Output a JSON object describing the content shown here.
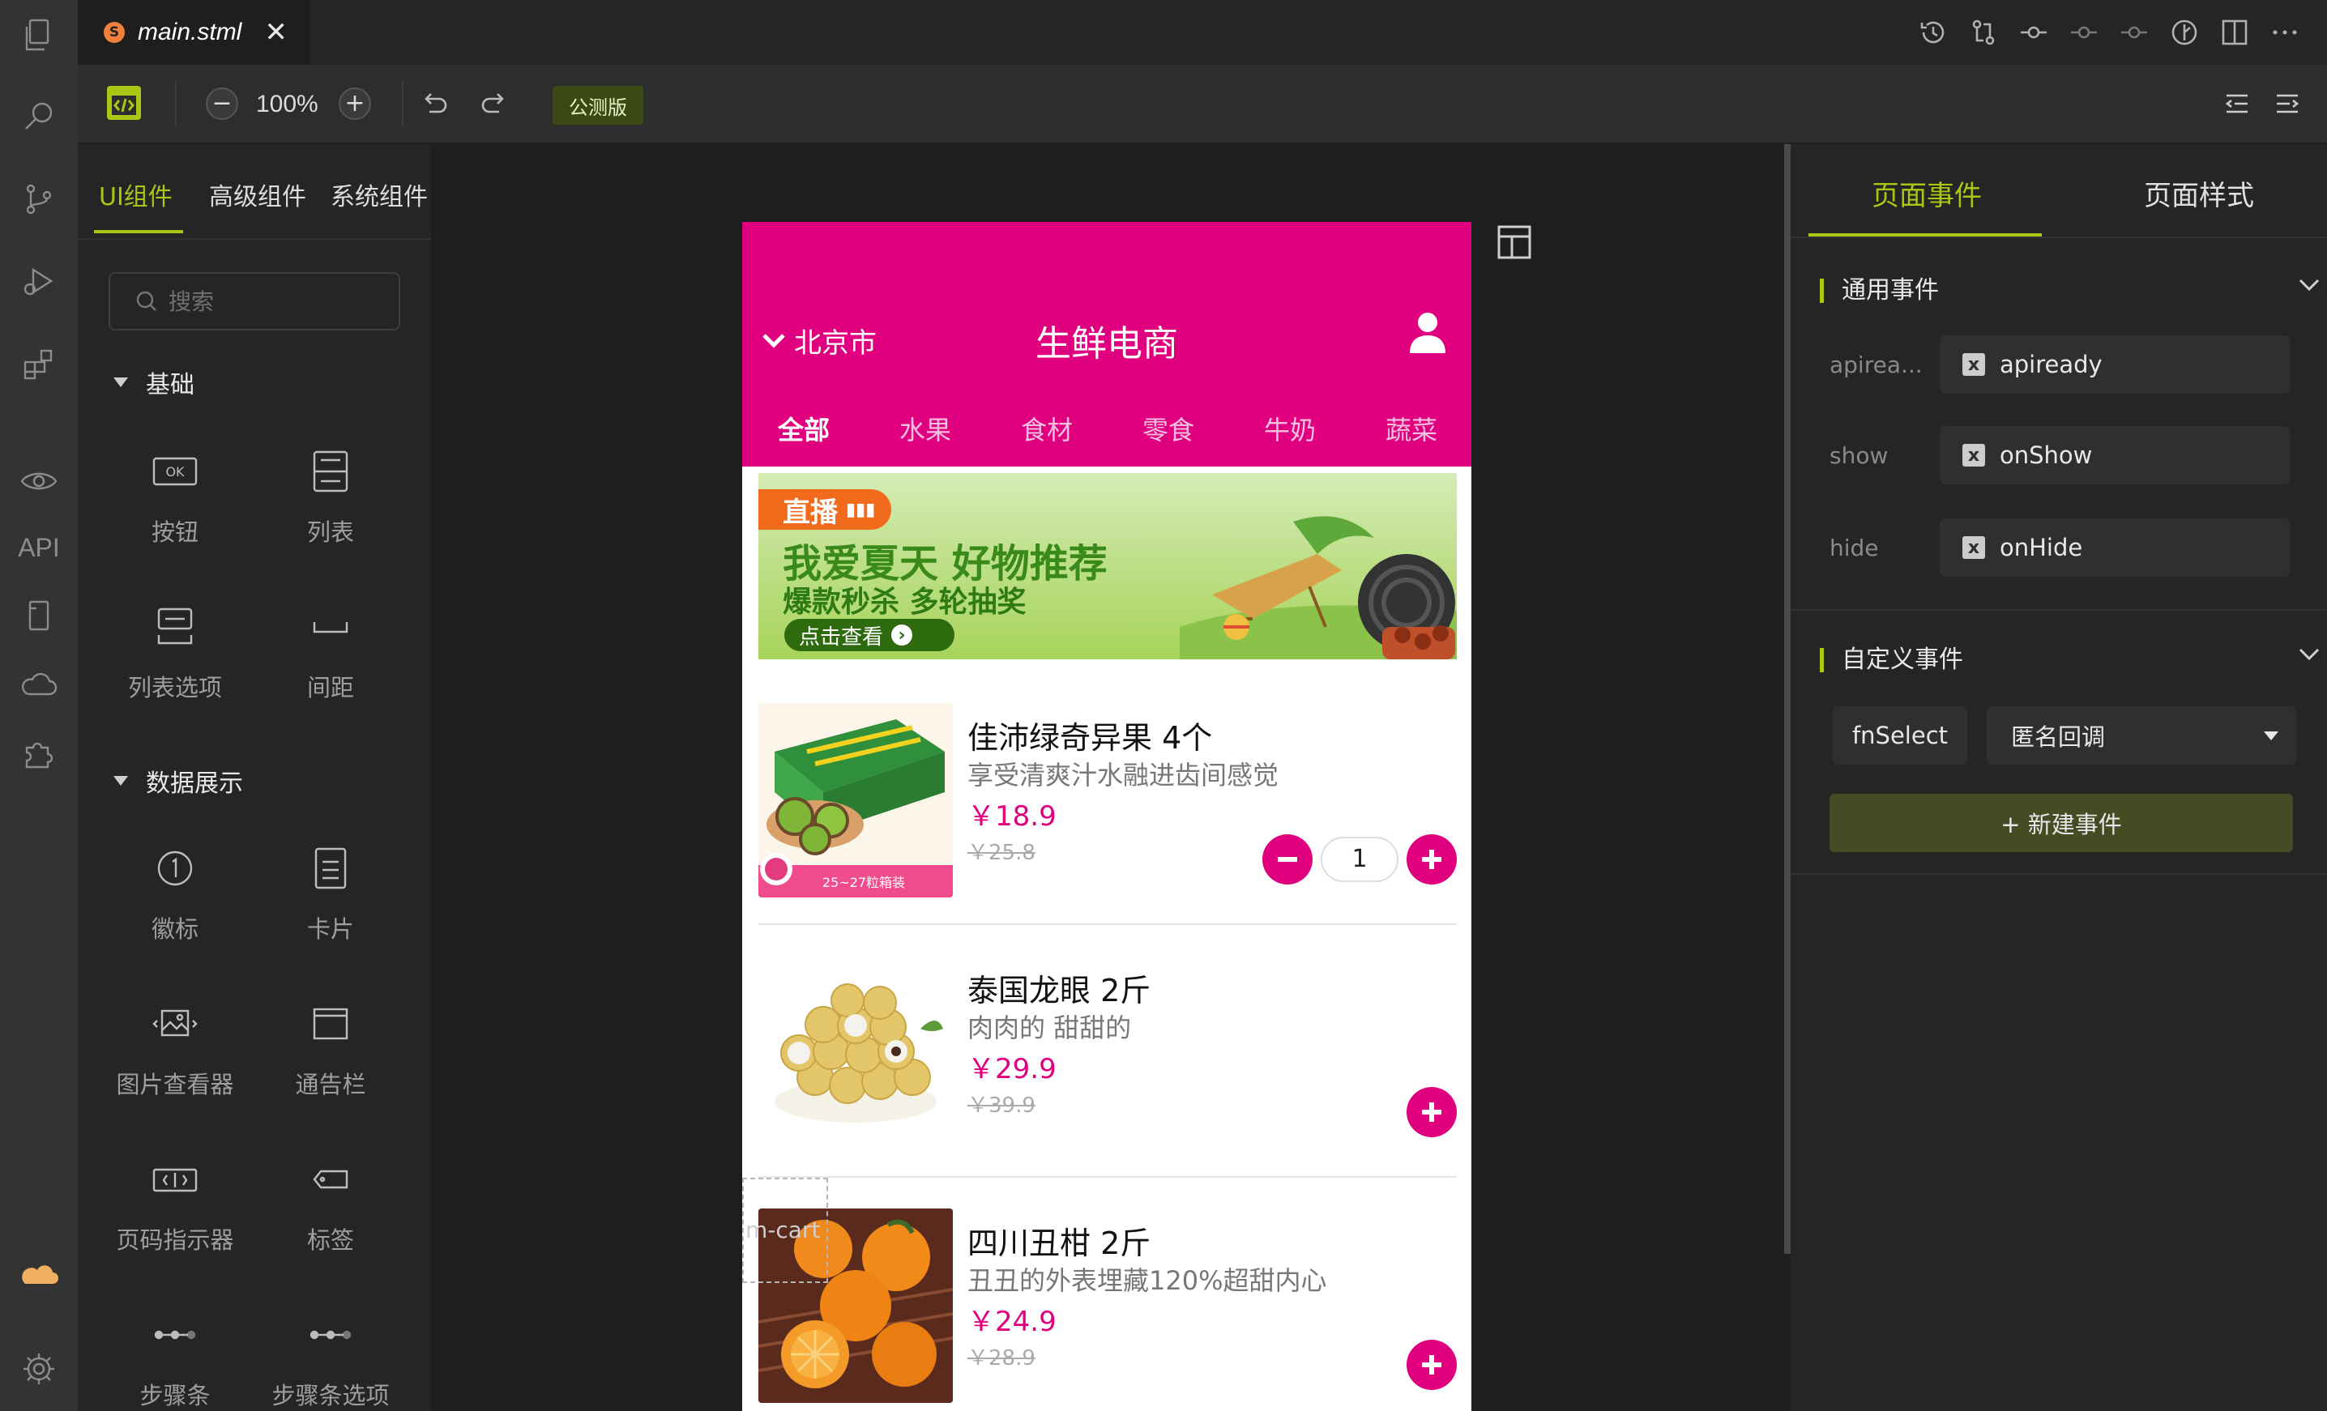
{
  "activity_bar": {
    "items": [
      "files-icon",
      "search-icon",
      "source-control-icon",
      "run-debug-icon",
      "extensions-icon",
      "preview-icon",
      "api-icon",
      "device-icon",
      "cloud-icon",
      "plugin-icon"
    ],
    "api_label": "API",
    "bottom": [
      "cloud-badge-icon",
      "settings-icon"
    ]
  },
  "tab": {
    "badge": "S",
    "filename": "main.stml",
    "close": "✕"
  },
  "toolbar": {
    "zoom": "100%",
    "zoom_out": "−",
    "zoom_in": "+",
    "beta_label": "公测版"
  },
  "left_panel": {
    "tabs": [
      "UI组件",
      "高级组件",
      "系统组件"
    ],
    "active_tab": 0,
    "search_placeholder": "搜索",
    "sections": [
      {
        "title": "基础",
        "items": [
          "按钮",
          "列表",
          "列表选项",
          "间距"
        ]
      },
      {
        "title": "数据展示",
        "items": [
          "徽标",
          "卡片",
          "图片查看器",
          "通告栏",
          "页码指示器",
          "标签",
          "步骤条",
          "步骤条选项"
        ]
      }
    ]
  },
  "phone": {
    "city": "北京市",
    "title": "生鲜电商",
    "categories": [
      "全部",
      "水果",
      "食材",
      "零食",
      "牛奶",
      "蔬菜"
    ],
    "active_category": 0,
    "banner": {
      "live": "直播",
      "headline": "我爱夏天 好物推荐",
      "sub": "爆款秒杀 多轮抽奖",
      "button": "点击查看",
      "button_arrow": "›"
    },
    "products": [
      {
        "name": "佳沛绿奇异果 4个",
        "desc": "享受清爽汁水融进齿间感觉",
        "price": "￥18.9",
        "old_price": "￥25.8",
        "tag": "25~27粒箱装",
        "quantity": "1"
      },
      {
        "name": "泰国龙眼 2斤",
        "desc": "肉肉的 甜甜的",
        "price": "￥29.9",
        "old_price": "￥39.9"
      },
      {
        "name": "四川丑柑 2斤",
        "desc": "丑丑的外表埋藏120%超甜内心",
        "price": "￥24.9",
        "old_price": "￥28.9",
        "overlay": "m-cart"
      }
    ],
    "colors": {
      "brand": "#e0007f"
    }
  },
  "right_panel": {
    "tabs": [
      "页面事件",
      "页面样式"
    ],
    "active_tab": 0,
    "common_events_title": "通用事件",
    "events": [
      {
        "label": "apirea...",
        "value": "apiready"
      },
      {
        "label": "show",
        "value": "onShow"
      },
      {
        "label": "hide",
        "value": "onHide"
      }
    ],
    "custom_events_title": "自定义事件",
    "custom_event": {
      "name": "fnSelect",
      "handler": "匿名回调"
    },
    "new_event_button": "+ 新建事件"
  },
  "accent_color": "#a8c813"
}
